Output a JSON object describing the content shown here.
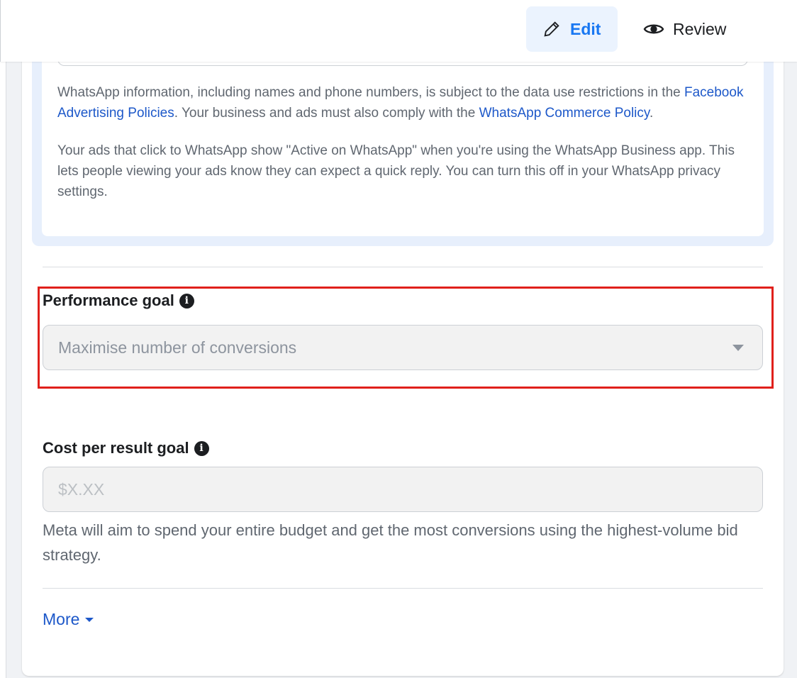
{
  "header": {
    "tabs": [
      {
        "label": "Edit",
        "icon": "pencil-icon",
        "active": true
      },
      {
        "label": "Review",
        "icon": "eye-icon",
        "active": false
      }
    ]
  },
  "notice": {
    "p1_a": "WhatsApp information, including names and phone numbers, is subject to the data use restrictions in the ",
    "p1_link1": "Facebook Advertising Policies",
    "p1_b": ". Your business and ads must also comply with the ",
    "p1_link2": "WhatsApp Commerce Policy",
    "p1_c": ".",
    "p2": "Your ads that click to WhatsApp show \"Active on WhatsApp\" when you're using the WhatsApp Business app. This lets people viewing your ads know they can expect a quick reply. You can turn this off in your WhatsApp privacy settings."
  },
  "performance_goal": {
    "label": "Performance goal",
    "value": "Maximise number of conversions"
  },
  "cost_goal": {
    "label": "Cost per result goal",
    "placeholder": "$X.XX",
    "help": "Meta will aim to spend your entire budget and get the most conversions using the highest-volume bid strategy."
  },
  "more": {
    "label": "More"
  },
  "colors": {
    "accent": "#1877f2",
    "link": "#1d58c9",
    "highlight": "#e0201b"
  }
}
